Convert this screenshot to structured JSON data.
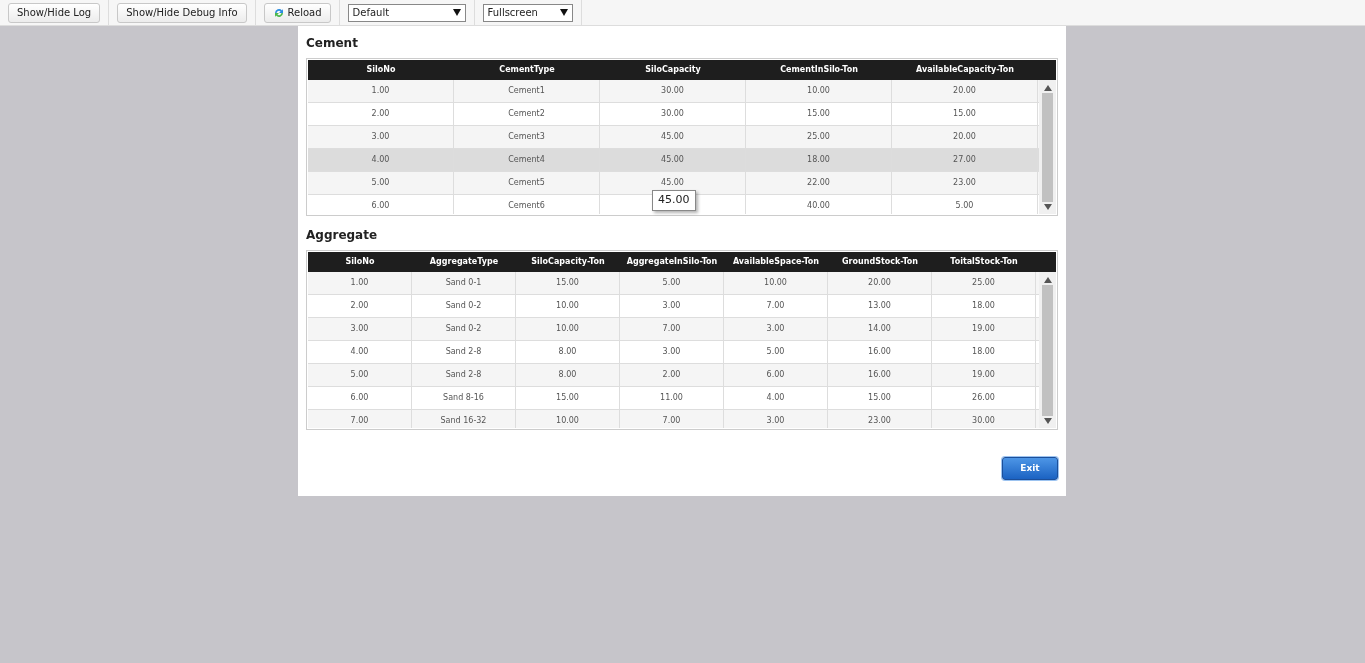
{
  "toolbar": {
    "buttons": [
      {
        "label": "Show/Hide Log",
        "kind": "plain"
      },
      {
        "label": "Show/Hide Debug Info",
        "kind": "plain"
      },
      {
        "label": "Reload",
        "kind": "reload"
      }
    ],
    "selects": [
      {
        "value": "Default"
      },
      {
        "value": "Fullscreen"
      }
    ]
  },
  "sections": [
    {
      "title": "Cement",
      "columns": [
        "SiloNo",
        "CementType",
        "SiloCapacity",
        "CementInSilo-Ton",
        "AvailableCapacity-Ton"
      ],
      "rows": [
        {
          "selected": false,
          "cells": [
            "1.00",
            "Cement1",
            "30.00",
            "10.00",
            "20.00"
          ]
        },
        {
          "selected": false,
          "cells": [
            "2.00",
            "Cement2",
            "30.00",
            "15.00",
            "15.00"
          ]
        },
        {
          "selected": false,
          "cells": [
            "3.00",
            "Cement3",
            "45.00",
            "25.00",
            "20.00"
          ]
        },
        {
          "selected": true,
          "cells": [
            "4.00",
            "Cement4",
            "45.00",
            "18.00",
            "27.00"
          ]
        },
        {
          "selected": false,
          "cells": [
            "5.00",
            "Cement5",
            "45.00",
            "22.00",
            "23.00"
          ]
        },
        {
          "selected": false,
          "cells": [
            "6.00",
            "Cement6",
            null,
            "40.00",
            "5.00"
          ]
        }
      ],
      "tooltip": {
        "text": "45.00"
      }
    },
    {
      "title": "Aggregate",
      "columns": [
        "SiloNo",
        "AggregateType",
        "SiloCapacity-Ton",
        "AggregateInSilo-Ton",
        "AvailableSpace-Ton",
        "GroundStock-Ton",
        "ToitalStock-Ton"
      ],
      "rows": [
        {
          "selected": false,
          "cells": [
            "1.00",
            "Sand 0-1",
            "15.00",
            "5.00",
            "10.00",
            "20.00",
            "25.00"
          ]
        },
        {
          "selected": false,
          "cells": [
            "2.00",
            "Sand 0-2",
            "10.00",
            "3.00",
            "7.00",
            "13.00",
            "18.00"
          ]
        },
        {
          "selected": false,
          "cells": [
            "3.00",
            "Sand 0-2",
            "10.00",
            "7.00",
            "3.00",
            "14.00",
            "19.00"
          ]
        },
        {
          "selected": false,
          "cells": [
            "4.00",
            "Sand 2-8",
            "8.00",
            "3.00",
            "5.00",
            "16.00",
            "18.00"
          ]
        },
        {
          "selected": false,
          "cells": [
            "5.00",
            "Sand 2-8",
            "8.00",
            "2.00",
            "6.00",
            "16.00",
            "19.00"
          ]
        },
        {
          "selected": false,
          "cells": [
            "6.00",
            "Sand 8-16",
            "15.00",
            "11.00",
            "4.00",
            "15.00",
            "26.00"
          ]
        },
        {
          "selected": false,
          "cells": [
            "7.00",
            "Sand 16-32",
            "10.00",
            "7.00",
            "3.00",
            "23.00",
            "30.00"
          ]
        }
      ]
    }
  ],
  "exit_button": {
    "label": "Exit"
  }
}
